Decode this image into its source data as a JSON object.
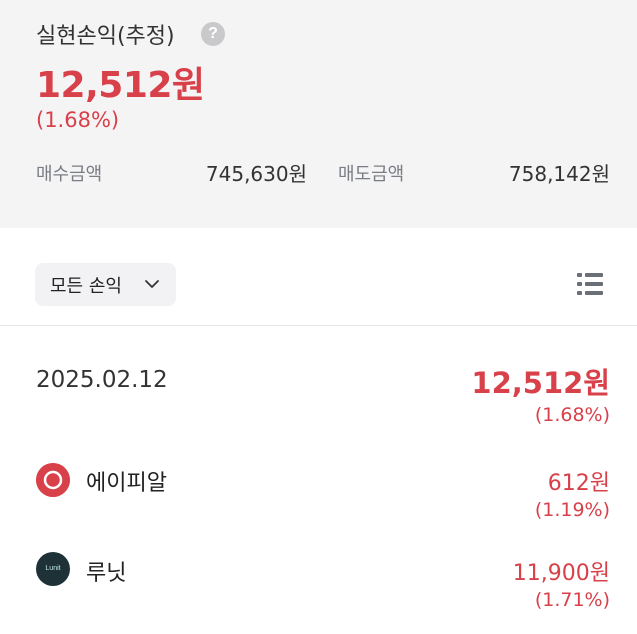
{
  "summary": {
    "title": "실현손익(추정)",
    "help_icon_glyph": "?",
    "total_amount": "12,512원",
    "total_rate": "(1.68%)",
    "buy_label": "매수금액",
    "buy_value": "745,630원",
    "sell_label": "매도금액",
    "sell_value": "758,142원"
  },
  "filter": {
    "label": "모든 손익",
    "icon": "chevron-down-icon"
  },
  "view_toggle_icon": "list-icon",
  "day": {
    "date": "2025.02.12",
    "amount": "12,512원",
    "rate": "(1.68%)"
  },
  "stocks": [
    {
      "name": "에이피알",
      "amount": "612원",
      "rate": "(1.19%)",
      "logo_color": "#d8404a"
    },
    {
      "name": "루닛",
      "amount": "11,900원",
      "rate": "(1.71%)",
      "logo_color": "#1e3136",
      "logo_text": "Lunit"
    }
  ],
  "colors": {
    "profit": "#d8404a",
    "summary_bg": "#f4f4f5",
    "label_gray": "#7a7d84"
  }
}
